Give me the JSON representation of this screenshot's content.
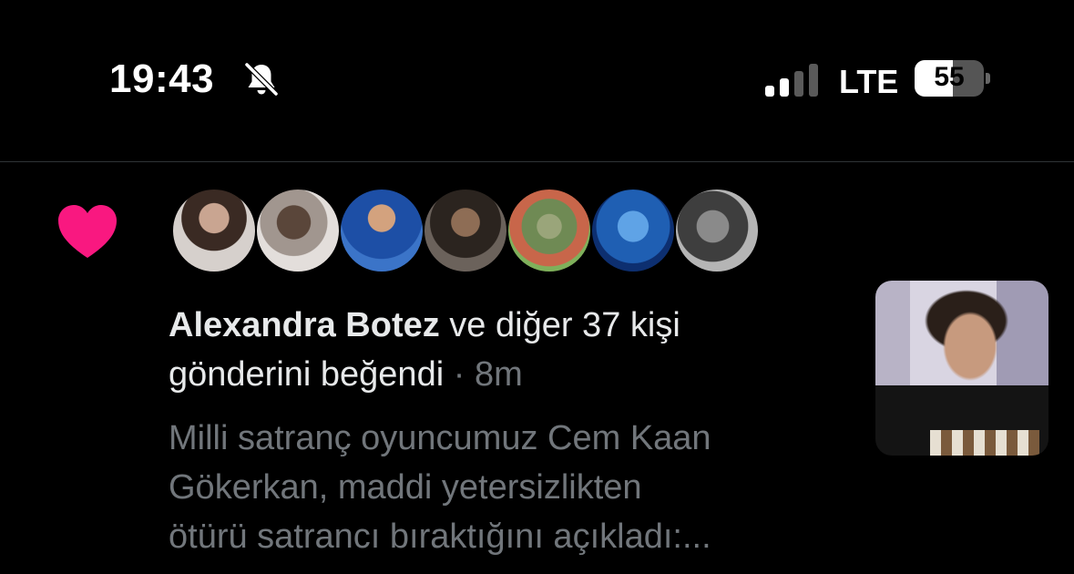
{
  "status_bar": {
    "time": "19:43",
    "network": "LTE",
    "battery_percent": "55",
    "battery_level": 0.55,
    "signal_bars_active": 2,
    "signal_bars_total": 4
  },
  "notification": {
    "type_icon": "heart-icon",
    "icon_color": "#f91880",
    "liker_count": 7,
    "actor": "Alexandra Botez",
    "action_text": " ve diğer 37 kişi gönderini beğendi",
    "separator": " · ",
    "time_ago": "8m",
    "snippet": "Milli satranç oyuncumuz Cem Kaan\nGökerkan, maddi yetersizlikten\nötürü satrancı bıraktığını açıkladı:..."
  }
}
